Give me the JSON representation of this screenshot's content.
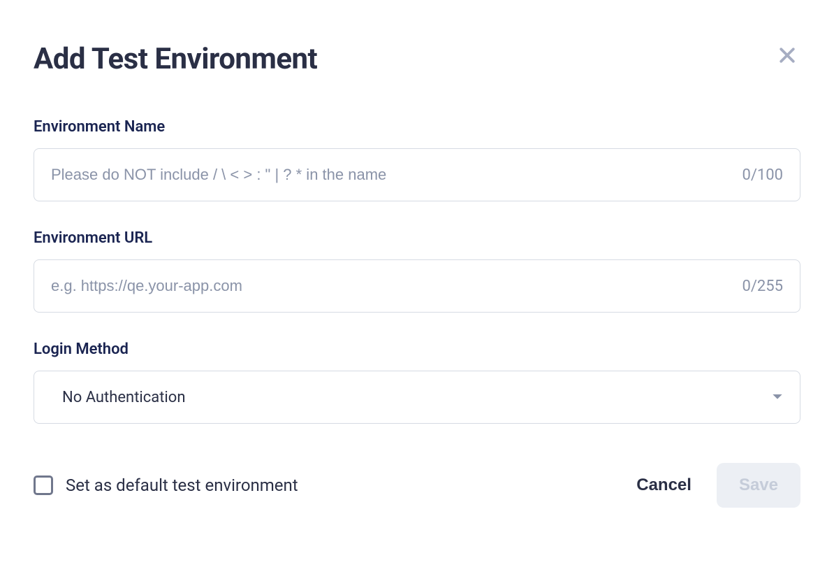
{
  "modal": {
    "title": "Add Test Environment",
    "fields": {
      "environment_name": {
        "label": "Environment Name",
        "placeholder": "Please do NOT include / \\ < > : \" | ? * in the name",
        "value": "",
        "counter": "0/100"
      },
      "environment_url": {
        "label": "Environment URL",
        "placeholder": "e.g. https://qe.your-app.com",
        "value": "",
        "counter": "0/255"
      },
      "login_method": {
        "label": "Login Method",
        "selected": "No Authentication"
      }
    },
    "checkbox": {
      "label": "Set as default test environment",
      "checked": false
    },
    "actions": {
      "cancel": "Cancel",
      "save": "Save"
    }
  }
}
